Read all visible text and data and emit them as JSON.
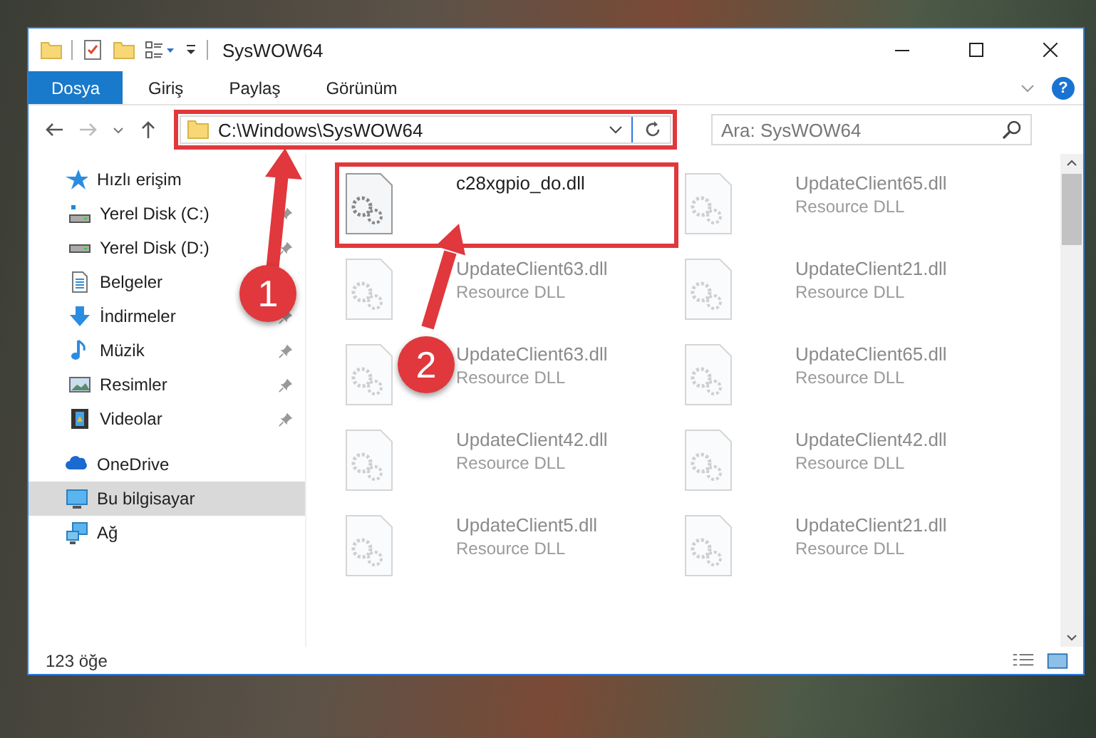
{
  "window": {
    "title": "SysWOW64"
  },
  "ribbon_tabs": [
    {
      "label": "Dosya",
      "selected": true
    },
    {
      "label": "Giriş",
      "selected": false
    },
    {
      "label": "Paylaş",
      "selected": false
    },
    {
      "label": "Görünüm",
      "selected": false
    }
  ],
  "help": "?",
  "address": {
    "path": "C:\\Windows\\SysWOW64",
    "highlighted": true
  },
  "search": {
    "placeholder": "Ara: SysWOW64"
  },
  "sidebar": {
    "items": [
      {
        "kind": "star",
        "label": "Hızlı erişim",
        "pinned": false,
        "selected": false,
        "children": [
          {
            "kind": "drive-c",
            "label": "Yerel Disk (C:)",
            "pinned": true,
            "selected": false
          },
          {
            "kind": "drive",
            "label": "Yerel Disk (D:)",
            "pinned": true,
            "selected": false
          },
          {
            "kind": "documents",
            "label": "Belgeler",
            "pinned": false,
            "selected": false
          },
          {
            "kind": "downloads",
            "label": "İndirmeler",
            "pinned": true,
            "selected": false
          },
          {
            "kind": "music",
            "label": "Müzik",
            "pinned": true,
            "selected": false
          },
          {
            "kind": "pictures",
            "label": "Resimler",
            "pinned": true,
            "selected": false
          },
          {
            "kind": "videos",
            "label": "Videolar",
            "pinned": true,
            "selected": false
          }
        ]
      },
      {
        "kind": "cloud",
        "label": "OneDrive",
        "pinned": false,
        "selected": false
      },
      {
        "kind": "computer",
        "label": "Bu bilgisayar",
        "pinned": false,
        "selected": true
      },
      {
        "kind": "network",
        "label": "Ağ",
        "pinned": false,
        "selected": false
      }
    ]
  },
  "files": [
    {
      "name": "c28xgpio_do.dll",
      "dimmed": false,
      "highlighted": true
    },
    {
      "name": "UpdateClient65.dll",
      "type": "Resource DLL",
      "dimmed": true,
      "highlighted": false
    },
    {
      "name": "UpdateClient63.dll",
      "type": "Resource DLL",
      "dimmed": true,
      "highlighted": false
    },
    {
      "name": "UpdateClient21.dll",
      "type": "Resource DLL",
      "dimmed": true,
      "highlighted": false
    },
    {
      "name": "UpdateClient63.dll",
      "type": "Resource DLL",
      "dimmed": true,
      "highlighted": false
    },
    {
      "name": "UpdateClient65.dll",
      "type": "Resource DLL",
      "dimmed": true,
      "highlighted": false
    },
    {
      "name": "UpdateClient42.dll",
      "type": "Resource DLL",
      "dimmed": true,
      "highlighted": false
    },
    {
      "name": "UpdateClient42.dll",
      "type": "Resource DLL",
      "dimmed": true,
      "highlighted": false
    },
    {
      "name": "UpdateClient5.dll",
      "type": "Resource DLL",
      "dimmed": true,
      "highlighted": false
    },
    {
      "name": "UpdateClient21.dll",
      "type": "Resource DLL",
      "dimmed": true,
      "highlighted": false
    }
  ],
  "status_bar": {
    "count": "123 öğe"
  },
  "annotations": [
    {
      "number": "1"
    },
    {
      "number": "2"
    }
  ]
}
